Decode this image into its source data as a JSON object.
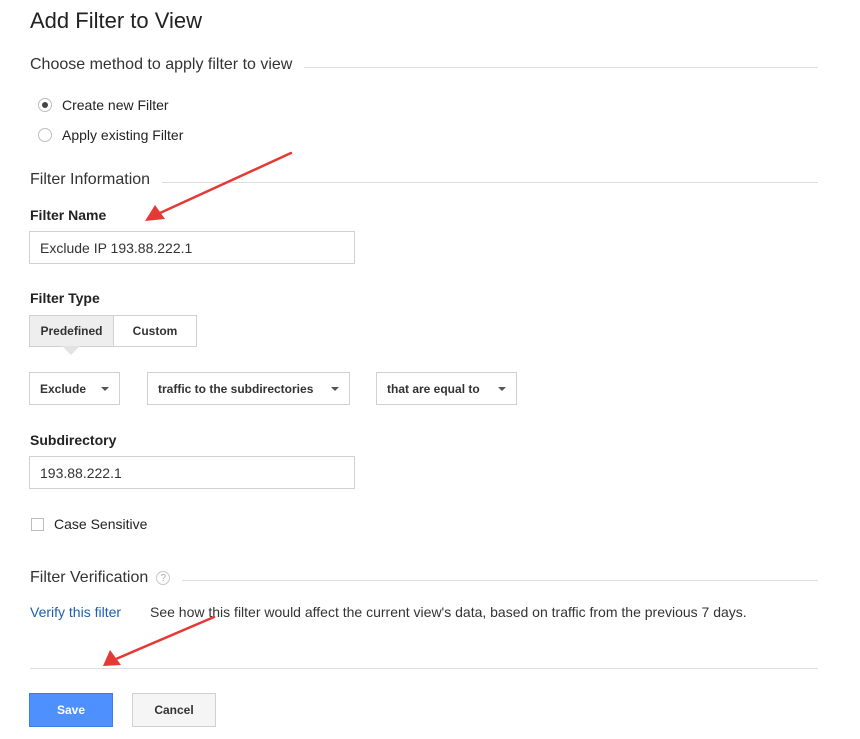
{
  "header": {
    "title": "Add Filter to View"
  },
  "method": {
    "title": "Choose method to apply filter to view",
    "options": [
      {
        "label": "Create new Filter",
        "checked": true
      },
      {
        "label": "Apply existing Filter",
        "checked": false
      }
    ]
  },
  "info": {
    "title": "Filter Information",
    "name_label": "Filter Name",
    "name_value": "Exclude IP 193.88.222.1"
  },
  "type": {
    "label": "Filter Type",
    "tabs": [
      "Predefined",
      "Custom"
    ],
    "active_tab": "Predefined",
    "dropdowns": [
      "Exclude",
      "traffic to the subdirectories",
      "that are equal to"
    ]
  },
  "subdirectory": {
    "label": "Subdirectory",
    "value": "193.88.222.1"
  },
  "case_sensitive": {
    "label": "Case Sensitive",
    "checked": false
  },
  "verification": {
    "title": "Filter Verification",
    "help_icon": "question-circle-icon",
    "link": "Verify this filter",
    "description": "See how this filter would affect the current view's data, based on traffic from the previous 7 days."
  },
  "actions": {
    "save": "Save",
    "cancel": "Cancel"
  },
  "colors": {
    "primary": "#4d90fe",
    "link": "#1a5fb4",
    "annotation_arrow": "#e53935"
  }
}
